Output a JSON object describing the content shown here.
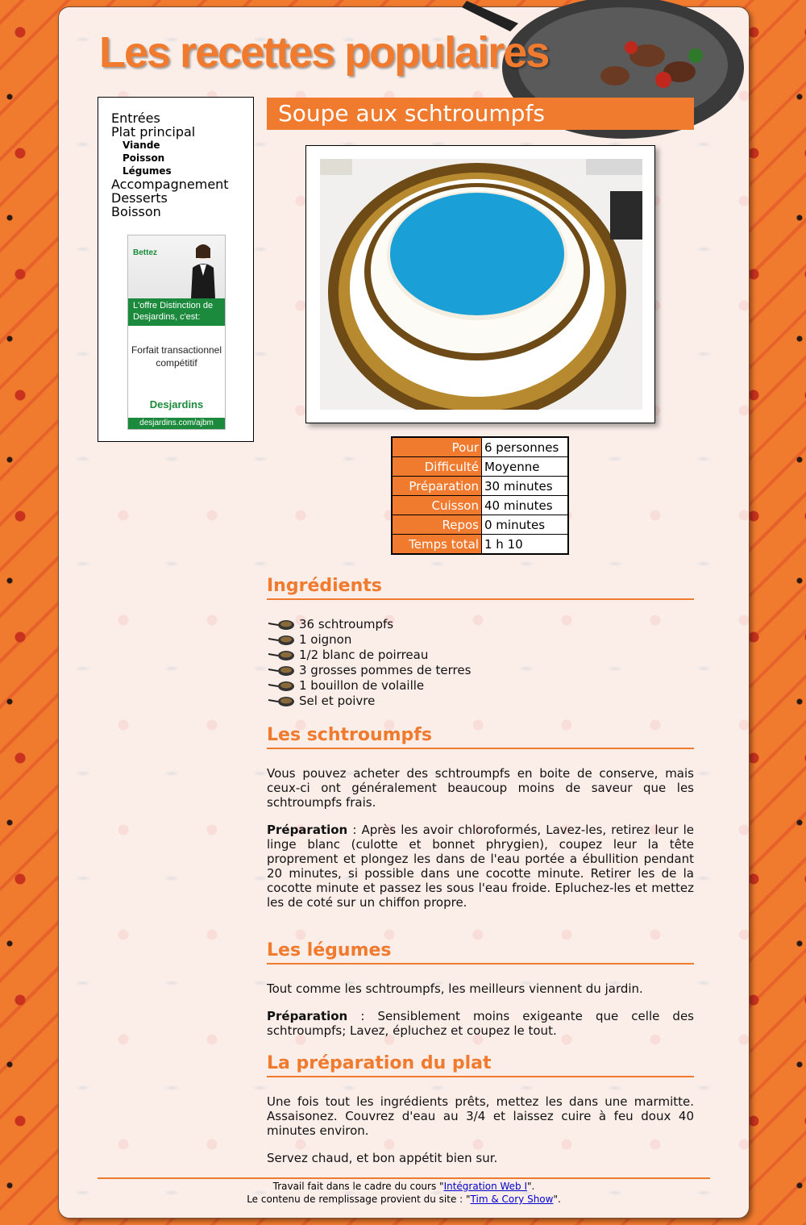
{
  "header": {
    "site_title": "Les recettes populaires"
  },
  "nav": {
    "items": [
      {
        "label": "Entrées",
        "level": "main"
      },
      {
        "label": "Plat principal",
        "level": "main"
      },
      {
        "label": "Viande",
        "level": "sub"
      },
      {
        "label": "Poisson",
        "level": "sub"
      },
      {
        "label": "Légumes",
        "level": "sub"
      },
      {
        "label": "Accompagnement",
        "level": "main"
      },
      {
        "label": "Desserts",
        "level": "main"
      },
      {
        "label": "Boisson",
        "level": "main"
      }
    ]
  },
  "ad": {
    "brand": "Bettez",
    "headline": "L'offre Distinction de Desjardins, c'est:",
    "body": "Forfait transactionnel compétitif",
    "logo": "Desjardins",
    "url": "desjardins.com/ajbm"
  },
  "recipe": {
    "title": "Soupe aux schtroumpfs",
    "info": [
      {
        "key": "Pour",
        "value": "6 personnes"
      },
      {
        "key": "Difficulté",
        "value": "Moyenne"
      },
      {
        "key": "Préparation",
        "value": "30 minutes"
      },
      {
        "key": "Cuisson",
        "value": "40 minutes"
      },
      {
        "key": "Repos",
        "value": "0 minutes"
      },
      {
        "key": "Temps total",
        "value": "1 h 10"
      }
    ],
    "ingredients_title": "Ingrédients",
    "ingredients": [
      "36 schtroumpfs",
      "1 oignon",
      "1/2 blanc de poirreau",
      "3 grosses pommes de terres",
      "1 bouillon de volaille",
      "Sel et poivre"
    ],
    "s1": {
      "title": "Les schtroumpfs",
      "intro": "Vous pouvez acheter des schtroumpfs en boite de conserve, mais ceux-ci ont généralement beaucoup moins de saveur que les schtroumpfs frais.",
      "prep_label": "Préparation",
      "prep_text": " : Après les avoir chloroformés, Lavez-les, retirez leur le linge blanc (culotte et bonnet phrygien), coupez leur la tête proprement et plongez les dans de l'eau portée a ébullition pendant 20 minutes, si possible dans une cocotte minute. Retirer les de la cocotte minute et passez les sous l'eau froide. Epluchez-les et mettez les de coté sur un chiffon propre."
    },
    "s2": {
      "title": "Les légumes",
      "intro": "Tout comme les schtroumpfs, les meilleurs viennent du jardin.",
      "prep_label": "Préparation",
      "prep_text": " : Sensiblement moins exigeante que celle des schtroumpfs; Lavez, épluchez et coupez le tout."
    },
    "s3": {
      "title": "La préparation du plat",
      "p1": "Une fois tout les ingrédients prêts, mettez les dans une marmitte. Assaisonez. Couvrez d'eau au 3/4 et laissez cuire à feu doux 40 minutes environ.",
      "p2": "Servez chaud, et bon appétit bien sur."
    }
  },
  "footer": {
    "line1_pre": "Travail fait dans le cadre du cours \"",
    "line1_link": "Intégration Web I",
    "line1_post": "\".",
    "line2_pre": "Le contenu de remplissage provient du site : \"",
    "line2_link": "Tim & Cory Show",
    "line2_post": "\"."
  },
  "colors": {
    "accent": "#f07a2e",
    "ad_green": "#1b8a3c",
    "soup_blue": "#1aa0d6"
  }
}
